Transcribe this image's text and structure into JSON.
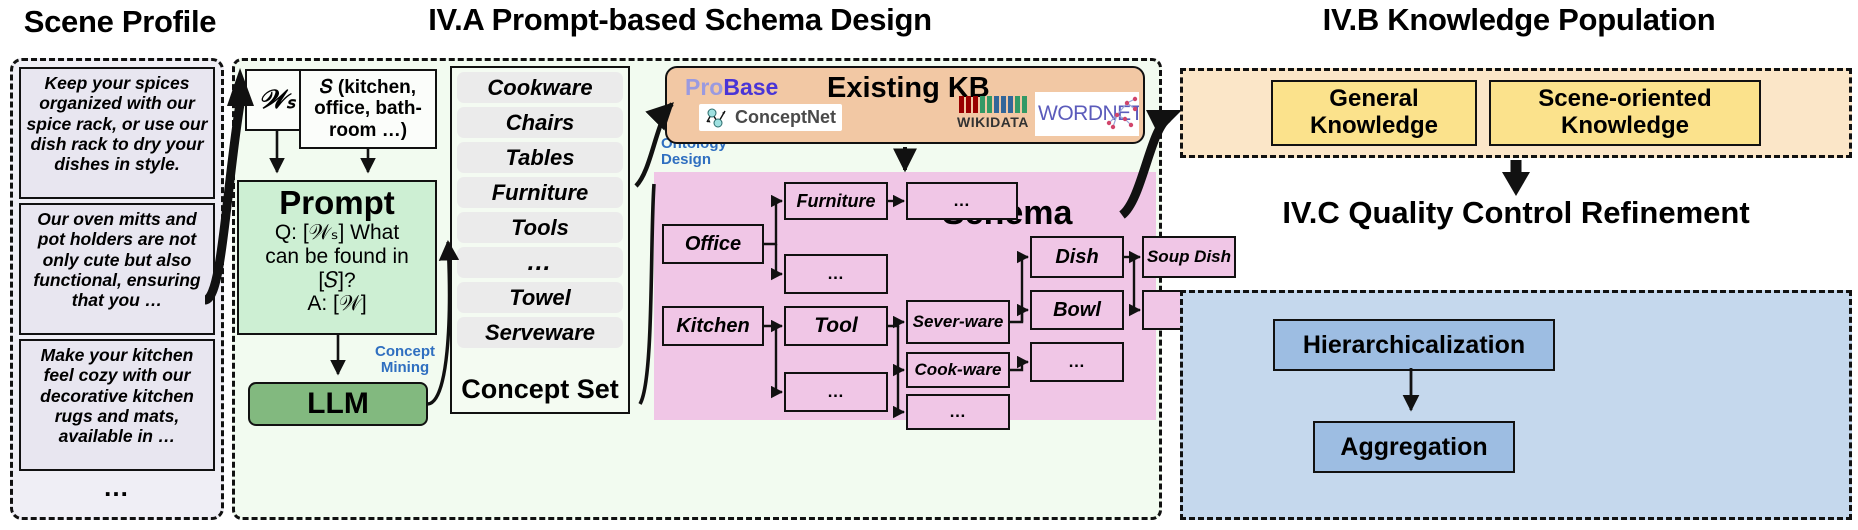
{
  "sections": {
    "scene_profile": {
      "title": "Scene Profile",
      "cards": [
        "Keep your spices organized with our spice rack, or use our dish rack to dry your dishes in style.",
        "Our oven mitts and pot holders are not only cute but also functional, ensuring that you …",
        "Make your kitchen feel cozy with our decorative kitchen rugs and mats, available in …"
      ],
      "more": "…"
    },
    "schema_design": {
      "title": "IV.A Prompt-based Schema Design",
      "ws_box": "𝒲ₛ",
      "s_box": "𝑆 (kitchen, office, bath-room …)",
      "prompt": {
        "title": "Prompt",
        "line1": "Q: [𝒲ₛ] What",
        "line2": "can be found  in",
        "line3": "[𝑆]?",
        "line4": "A: [𝒲]"
      },
      "llm": "LLM",
      "concept_mining_label": "Concept Mining",
      "ontology_design_label": "Ontology Design",
      "concept_set": {
        "items": [
          "Cookware",
          "Chairs",
          "Tables",
          "Furniture",
          "Tools",
          "…",
          "Towel",
          "Serveware"
        ],
        "label": "Concept Set"
      },
      "existing_kb": {
        "title": "Existing KB",
        "probase_pro": "Pro",
        "probase_base": "Base",
        "conceptnet": "ConceptNet",
        "wikidata": "WIKIDATA",
        "wordnet": "WORDNET"
      },
      "schema": {
        "title": "Schema",
        "nodes": [
          "Office",
          "Furniture",
          "…",
          "…",
          "Kitchen",
          "Tool",
          "…",
          "Sever-ware",
          "Cook-ware",
          "…",
          "Dish",
          "Soup Dish",
          "Bowl",
          "…",
          "…"
        ]
      }
    },
    "knowledge_population": {
      "title": "IV.B Knowledge Population",
      "boxes": [
        "General Knowledge",
        "Scene-oriented Knowledge"
      ]
    },
    "quality_control": {
      "title": "IV.C Quality Control Refinement",
      "boxes": [
        "Hierarchicalization",
        "Aggregation"
      ]
    }
  },
  "colors": {
    "scene_panel": "#efeef5",
    "iva_panel": "#f2fbf0",
    "prompt": "#cdefd3",
    "llm": "#82b97f",
    "kb": "#f2c8a4",
    "schema": "#f0c6e6",
    "ivb": "#fbe6c8",
    "ivb_box": "#fbe28c",
    "ivc": "#c5d8ed",
    "ivc_box": "#9dbde2",
    "blue_label": "#2f6fc0"
  }
}
